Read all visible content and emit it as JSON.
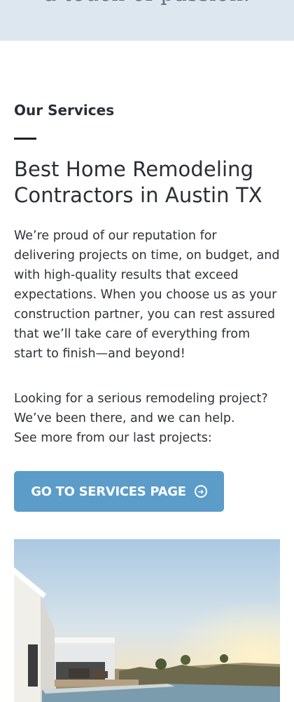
{
  "top_band": {
    "tagline": "a touch of passion."
  },
  "services": {
    "eyebrow": "Our Services",
    "heading": "Best Home Remodeling Contractors in Austin TX",
    "paragraph_1": "We’re proud of our reputation for delivering projects on time, on budget, and with high-quality results that exceed expectations. When you choose us as your construction partner, you can rest assured that we’ll take care of everything from start to finish—and beyond!",
    "paragraph_2_lines": [
      "Looking for a serious remodeling project?",
      "We’ve been there, and we can help.",
      "See more from our last projects:"
    ],
    "cta_label": "GO TO SERVICES PAGE",
    "cta_icon": "arrow-right-circle-icon"
  },
  "colors": {
    "band": "#dde7f0",
    "button": "#5b9cc9",
    "text": "#2b2e35"
  }
}
